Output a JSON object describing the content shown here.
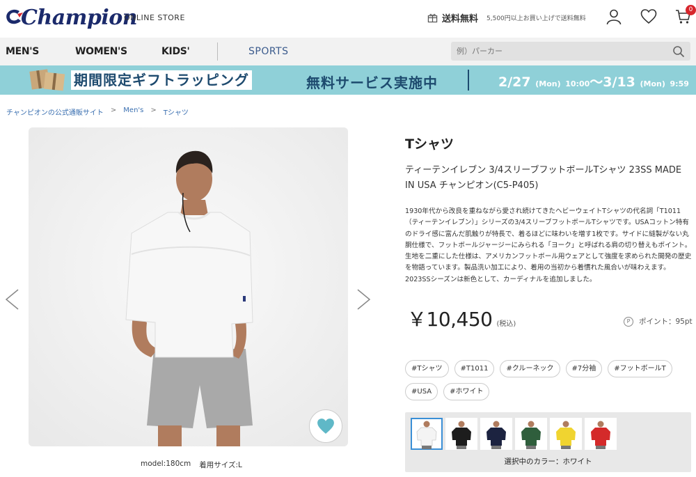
{
  "header": {
    "logo_text": "Champion",
    "store_label": "ONLINE STORE",
    "shipping_free": "送料無料",
    "shipping_condition": "5,500円以上お買い上げで送料無料",
    "cart_count": "0",
    "icons": [
      "account-icon",
      "heart-icon",
      "cart-icon"
    ]
  },
  "nav": {
    "items": [
      "MEN'S",
      "WOMEN'S",
      "KIDS'"
    ],
    "sports": "SPORTS",
    "search_placeholder": "例）パーカー"
  },
  "banner": {
    "title": "期間限定ギフトラッピング",
    "free_service": "無料サービス実施中",
    "date_start": "2/27",
    "date_start_day": "(Mon)",
    "time_start": "10:00",
    "tilde": "～",
    "date_end": "3/13",
    "date_end_day": "(Mon)",
    "time_end": "9:59"
  },
  "breadcrumb": [
    "チャンピオンの公式通販サイト",
    "Men's",
    "Tシャツ"
  ],
  "breadcrumb_sep": ">",
  "gallery": {
    "model_height": "model:180cm",
    "model_size": "着用サイズ:L"
  },
  "product": {
    "category": "Tシャツ",
    "name": "ティーテンイレブン 3/4スリーブフットボールTシャツ 23SS MADE IN USA チャンピオン(C5-P405)",
    "description": "1930年代から改良を重ねながら愛され続けてきたヘビーウェイトTシャツの代名詞「T1011（ティーテンイレブン）」シリーズの3/4スリーブフットボールTシャツです。USAコットン特有のドライ感に富んだ肌触りが特長で、着るほどに味わいを増す1枚です。サイドに縫製がない丸胴仕様で、フットボールジャージーにみられる「ヨーク」と呼ばれる肩の切り替えもポイント。生地を二重にした仕様は、アメリカンフットボール用ウェアとして強度を求められた開発の歴史を物語っています。製品洗い加工により、着用の当初から着慣れた風合いが味わえます。2023SSシーズンは新色として、カーディナルを追加しました。",
    "price": "￥10,450",
    "tax_label": "(税込)",
    "point_icon": "P",
    "points": "ポイント：95pt",
    "tags": [
      "#Tシャツ",
      "#T1011",
      "#クルーネック",
      "#7分袖",
      "#フットボールT",
      "#USA",
      "#ホワイト"
    ],
    "color_label": "選択中のカラー：ホワイト",
    "swatch_colors": [
      "#f4f4f4",
      "#1d1d1d",
      "#1c2340",
      "#2f5e3c",
      "#f0d430",
      "#d42a2a"
    ]
  },
  "colors": {
    "banner_bg": "#8fd0d8",
    "banner_text": "#1d4a6e",
    "accent": "#3a8fd6",
    "badge": "#d7262c",
    "fav": "#5fb8c7"
  }
}
